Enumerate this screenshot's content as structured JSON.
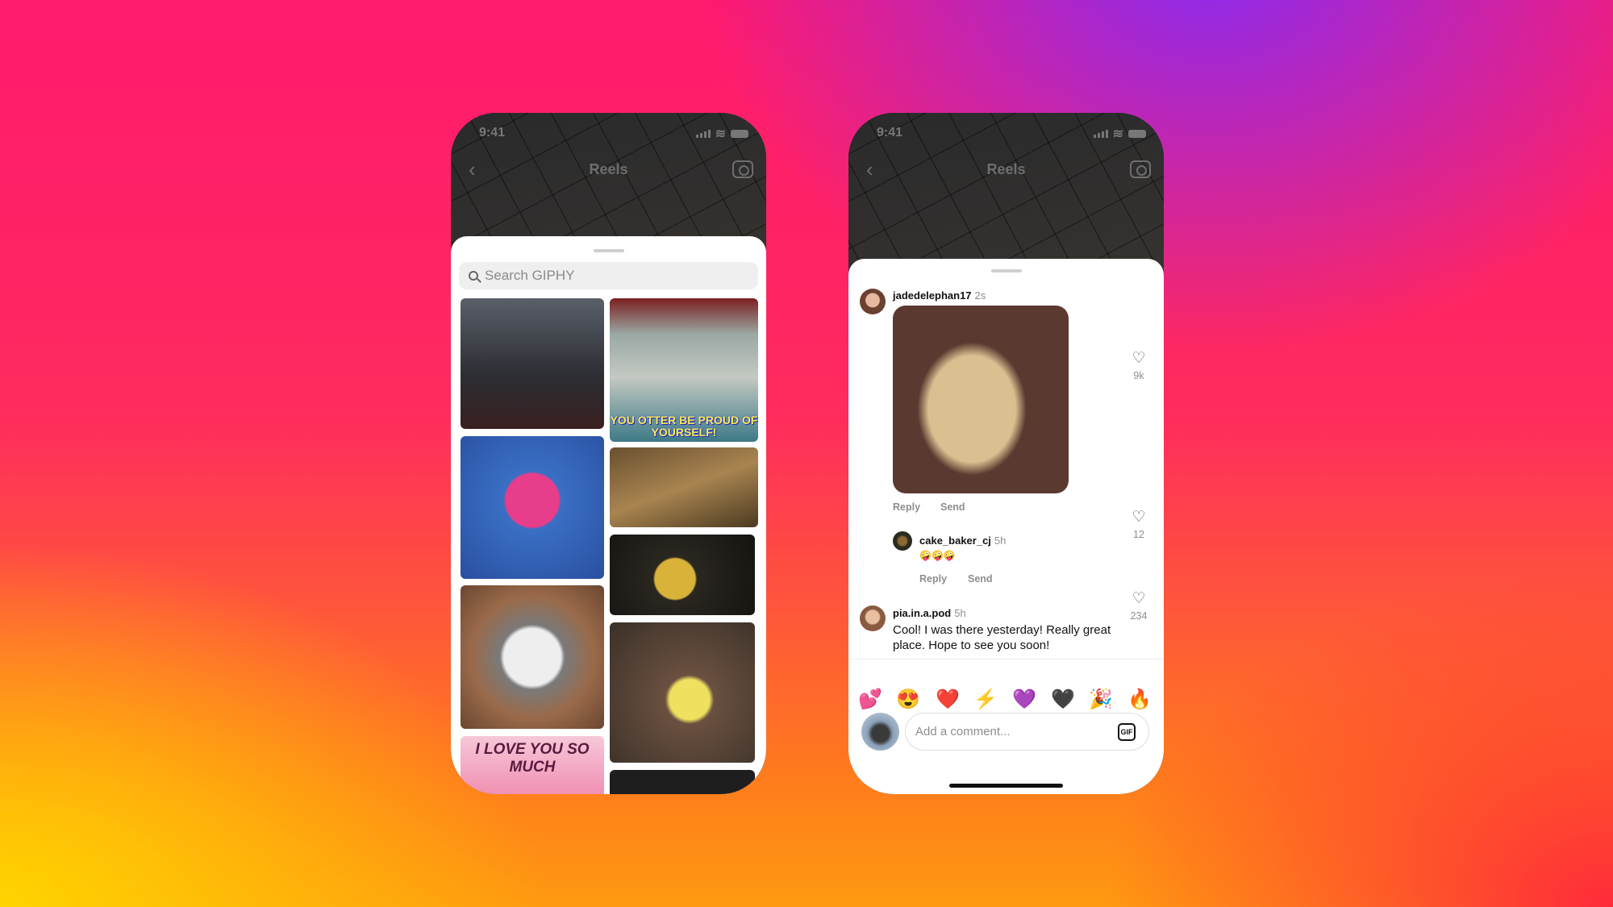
{
  "status_bar": {
    "time": "9:41"
  },
  "nav": {
    "title": "Reels",
    "back_icon": "chevron-left-icon",
    "camera_icon": "camera-icon"
  },
  "giphy": {
    "search_placeholder": "Search GIPHY",
    "tiles": [
      {
        "caption": "",
        "name": "gif-soccer-player"
      },
      {
        "caption": "YOU OTTER BE PROUD OF YOURSELF!",
        "name": "gif-otter"
      },
      {
        "caption": "",
        "name": "gif-fall-guy"
      },
      {
        "caption": "",
        "name": "gif-lioness"
      },
      {
        "caption": "",
        "name": "gif-pikachu"
      },
      {
        "caption": "",
        "name": "gif-husky"
      },
      {
        "caption": "",
        "name": "gif-girl-cotton-candy"
      },
      {
        "caption": "I LOVE YOU SO MUCH",
        "name": "gif-love-donuts"
      },
      {
        "caption": "",
        "name": "gif-dark"
      }
    ]
  },
  "comments": [
    {
      "user": "jadedelephan17",
      "time": "2s",
      "likes": "9k",
      "reply": "Reply",
      "send": "Send"
    },
    {
      "user": "cake_baker_cj",
      "time": "5h",
      "text": "🤪🤪🤪",
      "likes": "12",
      "reply": "Reply",
      "send": "Send"
    },
    {
      "user": "pia.in.a.pod",
      "time": "5h",
      "text": "Cool! I was there yesterday! Really great place. Hope to see you soon!",
      "likes": "234",
      "reply": "Reply",
      "send": "Send"
    }
  ],
  "emoji_bar": [
    "💕",
    "😍",
    "❤️",
    "⚡",
    "💜",
    "🖤",
    "🎉",
    "🔥"
  ],
  "composer": {
    "placeholder": "Add a comment...",
    "gif_label": "GIF"
  },
  "colors": {
    "bg_pink": "#ff1a6e",
    "bg_purple": "#8a2cf0",
    "bg_yellow": "#ffd400",
    "bg_orange": "#ff7a1e"
  }
}
